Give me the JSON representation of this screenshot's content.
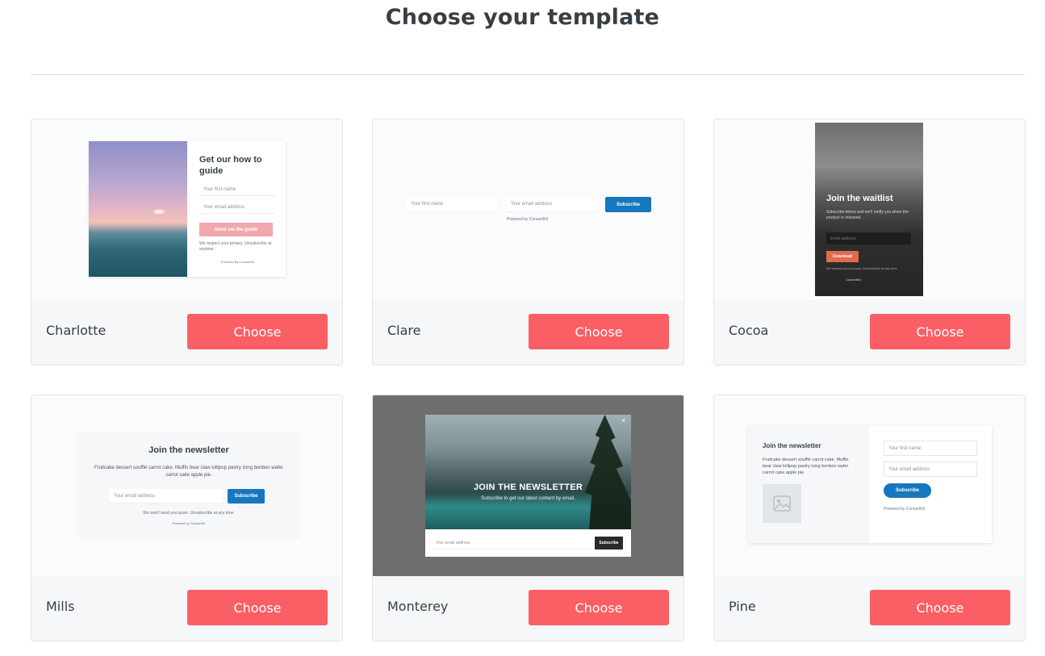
{
  "page": {
    "title": "Choose your template"
  },
  "templates": [
    {
      "name": "Charlotte",
      "choose_label": "Choose",
      "preview": {
        "title": "Get our how to guide",
        "first_name_placeholder": "Your first name",
        "email_placeholder": "Your email address",
        "button": "Send me the guide",
        "privacy": "We respect your privacy. Unsubscribe at anytime.",
        "powered": "Powered By ConvertKit"
      }
    },
    {
      "name": "Clare",
      "choose_label": "Choose",
      "preview": {
        "first_name_placeholder": "Your first name",
        "email_placeholder": "Your email address",
        "button": "Subscribe",
        "powered": "Powered by ConvertKit"
      }
    },
    {
      "name": "Cocoa",
      "choose_label": "Choose",
      "preview": {
        "title": "Join the waitlist",
        "subtitle": "Subscribe below and we'll notify you when the product is released.",
        "email_placeholder": "Email address",
        "button": "Download",
        "privacy": "We respect your privacy. Unsubscribe at any time.",
        "powered": "ConvertKit"
      }
    },
    {
      "name": "Mills",
      "choose_label": "Choose",
      "preview": {
        "title": "Join the newsletter",
        "body": "Fruitcake dessert soufflé carrot cake. Muffin bear claw lollipop pastry icing bonbon wafer carrot cake apple pie.",
        "email_placeholder": "Your email address",
        "button": "Subscribe",
        "privacy": "We won't send you spam. Unsubscribe at any time.",
        "powered": "Powered by ConvertKit"
      }
    },
    {
      "name": "Monterey",
      "choose_label": "Choose",
      "preview": {
        "title": "JOIN THE NEWSLETTER",
        "subtitle": "Subscribe to get our latest content by email.",
        "email_placeholder": "Your email address",
        "button": "Subscribe",
        "close": "×"
      }
    },
    {
      "name": "Pine",
      "choose_label": "Choose",
      "preview": {
        "title": "Join the newsletter",
        "body": "Fruitcake dessert soufflé carrot cake. Muffin bear claw lollipop pastry icing bonbon wafer carrot cake apple pie.",
        "first_name_placeholder": "Your first name",
        "email_placeholder": "Your email address",
        "button": "Subscribe",
        "powered": "Powered by ConvertKit"
      }
    }
  ],
  "colors": {
    "choose_button": "#fb5e65",
    "accent_blue": "#1677be",
    "divider": "#d6dadd"
  }
}
